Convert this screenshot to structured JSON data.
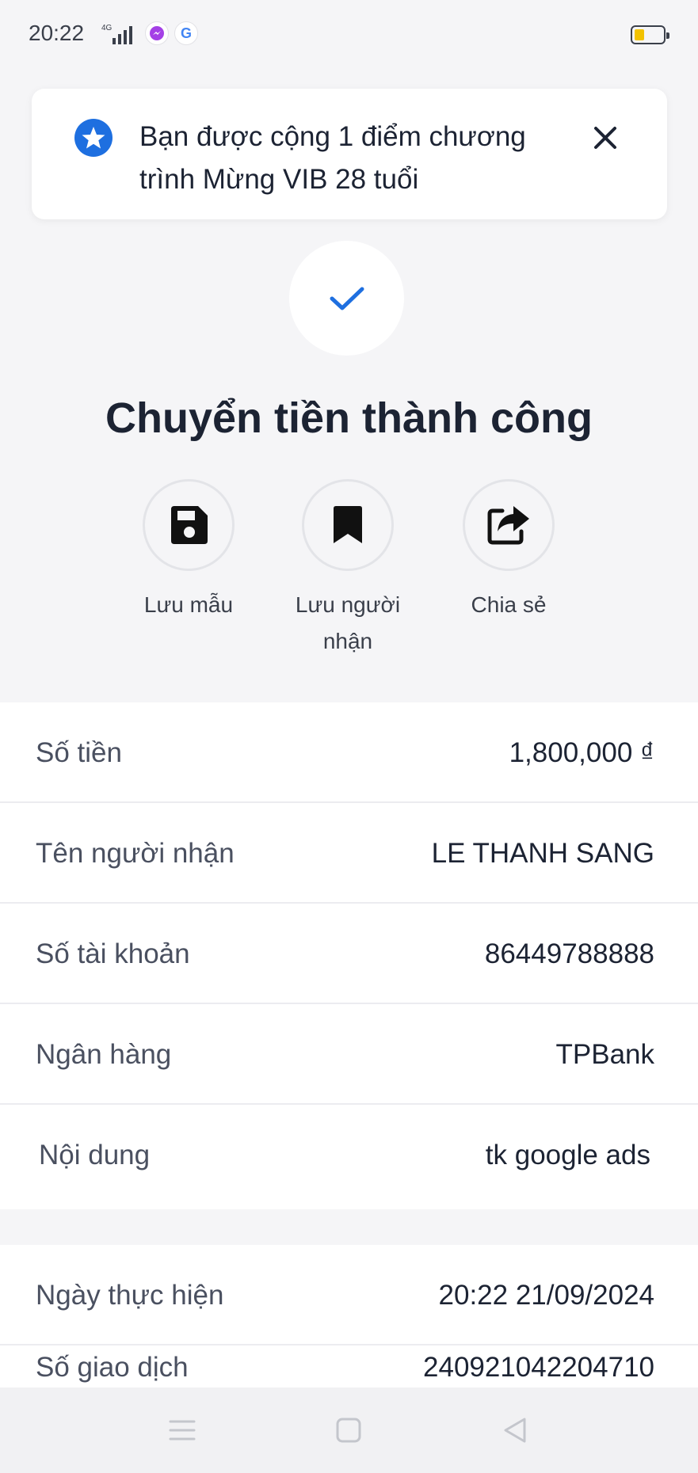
{
  "status_bar": {
    "time": "20:22",
    "network": "4G",
    "apps": [
      "messenger-icon",
      "google-icon"
    ],
    "google_letter": "G",
    "battery_color": "#f2c200"
  },
  "notification": {
    "text": "Bạn được cộng 1 điểm chương trình Mừng VIB 28 tuổi",
    "icon": "star-icon",
    "icon_color": "#1e6fe0"
  },
  "success": {
    "title": "Chuyển tiền thành công",
    "accent": "#1e6fe0"
  },
  "actions": [
    {
      "label": "Lưu mẫu",
      "icon": "save-icon"
    },
    {
      "label": "Lưu người nhận",
      "icon": "bookmark-icon"
    },
    {
      "label": "Chia sẻ",
      "icon": "share-icon"
    }
  ],
  "details": [
    {
      "label": "Số tiền",
      "value": "1,800,000 ₫"
    },
    {
      "label": "Tên người nhận",
      "value": "LE THANH SANG"
    },
    {
      "label": "Số tài khoản",
      "value": "86449788888"
    },
    {
      "label": "Ngân hàng",
      "value": "TPBank"
    },
    {
      "label": "Nội dung",
      "value": "tk google ads"
    }
  ],
  "details2": [
    {
      "label": "Ngày thực hiện",
      "value": "20:22 21/09/2024"
    }
  ],
  "partial_row": {
    "label": "Số giao dịch",
    "value": "240921042204710"
  },
  "navbar": [
    "menu-icon",
    "home-icon",
    "back-icon"
  ]
}
